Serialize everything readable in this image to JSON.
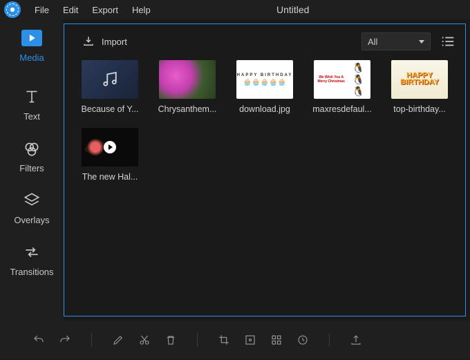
{
  "title": "Untitled",
  "menubar": [
    "File",
    "Edit",
    "Export",
    "Help"
  ],
  "sidebar": {
    "items": [
      {
        "label": "Media"
      },
      {
        "label": "Text"
      },
      {
        "label": "Filters"
      },
      {
        "label": "Overlays"
      },
      {
        "label": "Transitions"
      }
    ]
  },
  "toolbar": {
    "import": "Import",
    "filter_dropdown": "All"
  },
  "media": [
    {
      "label": "Because of Y..."
    },
    {
      "label": "Chrysanthem..."
    },
    {
      "label": "download.jpg"
    },
    {
      "label": "maxresdefaul..."
    },
    {
      "label": "top-birthday..."
    },
    {
      "label": "The new Hal..."
    }
  ]
}
